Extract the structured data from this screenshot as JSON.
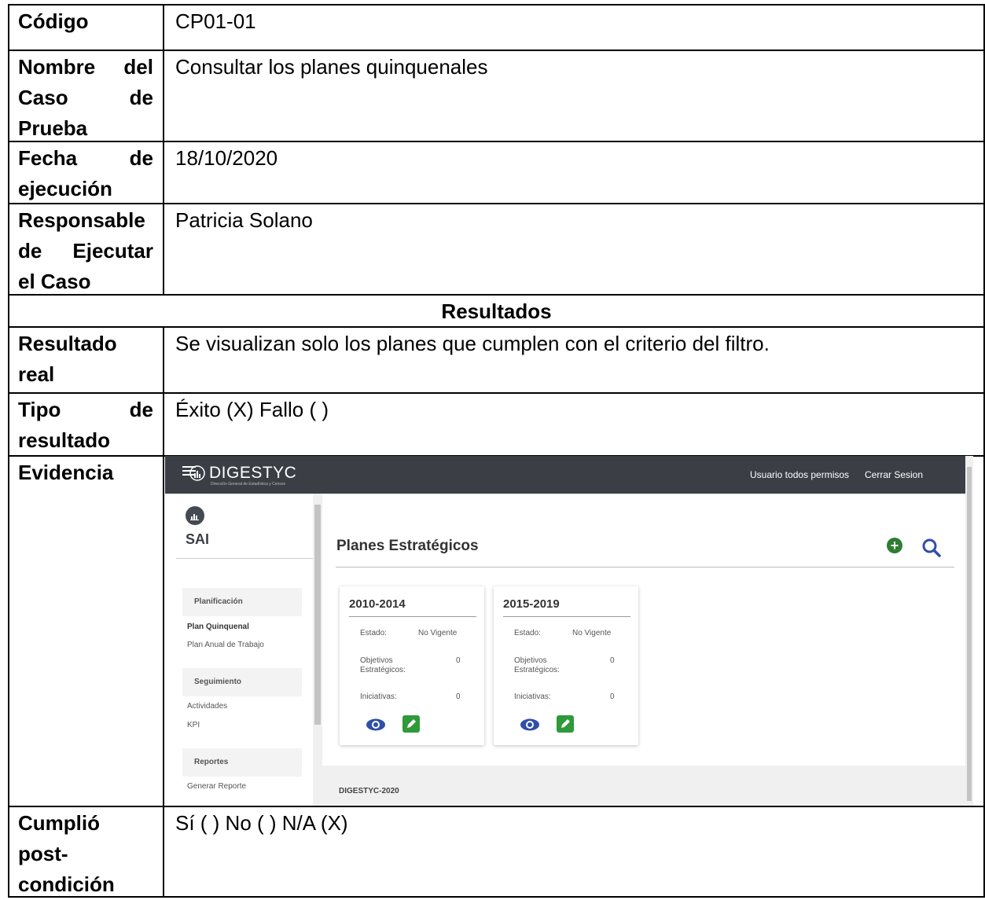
{
  "table": {
    "codigo": {
      "label": "Código",
      "value": "CP01-01"
    },
    "nombre": {
      "label_lines": [
        "Nombre del",
        "Caso de",
        "Prueba"
      ],
      "value": "Consultar los planes quinquenales"
    },
    "fecha": {
      "label_lines": [
        "Fecha de",
        "ejecución"
      ],
      "value": "18/10/2020"
    },
    "responsable": {
      "label_lines": [
        "Responsable",
        "de Ejecutar",
        "el Caso"
      ],
      "value": "Patricia Solano"
    },
    "resultados_header": "Resultados",
    "resultado_real": {
      "label_lines": [
        "Resultado",
        "real"
      ],
      "value": "Se visualizan solo los planes que cumplen con el criterio del filtro."
    },
    "tipo": {
      "label_lines": [
        "Tipo de",
        "resultado"
      ],
      "value": "Éxito (X) Fallo ( )"
    },
    "evidencia": {
      "label": "Evidencia"
    },
    "cumplio": {
      "label_lines": [
        "Cumplió",
        "post-",
        "condición"
      ],
      "value": "Sí ( )  No ( )  N/A (X)"
    }
  },
  "app": {
    "brand": "DIGESTYC",
    "brand_subtitle": "Dirección General de Estadística y Censos",
    "top_user": "Usuario todos permisos",
    "top_logout": "Cerrar Sesion",
    "sidebar": {
      "title": "SAI",
      "groups": [
        {
          "header": "Planificación",
          "items": [
            "Plan Quinquenal",
            "Plan Anual de Trabajo"
          ]
        },
        {
          "header": "Seguimiento",
          "items": [
            "Actividades",
            "KPI"
          ]
        },
        {
          "header": "Reportes",
          "items": [
            "Generar Reporte"
          ]
        }
      ]
    },
    "page_title": "Planes Estratégicos",
    "cards": [
      {
        "period": "2010-2014",
        "estado_label": "Estado:",
        "estado": "No Vigente",
        "objetivos_label": "Objetivos Estratégicos:",
        "objetivos": "0",
        "iniciativas_label": "Iniciativas:",
        "iniciativas": "0"
      },
      {
        "period": "2015-2019",
        "estado_label": "Estado:",
        "estado": "No Vigente",
        "objetivos_label": "Objetivos Estratégicos:",
        "objetivos": "0",
        "iniciativas_label": "Iniciativas:",
        "iniciativas": "0"
      }
    ],
    "footer": "DIGESTYC-2020",
    "colors": {
      "topbar": "#3b3f45",
      "add": "#2e7d32",
      "edit": "#2e9a3a",
      "view": "#2f4fa8",
      "search": "#2f4fa8"
    }
  }
}
